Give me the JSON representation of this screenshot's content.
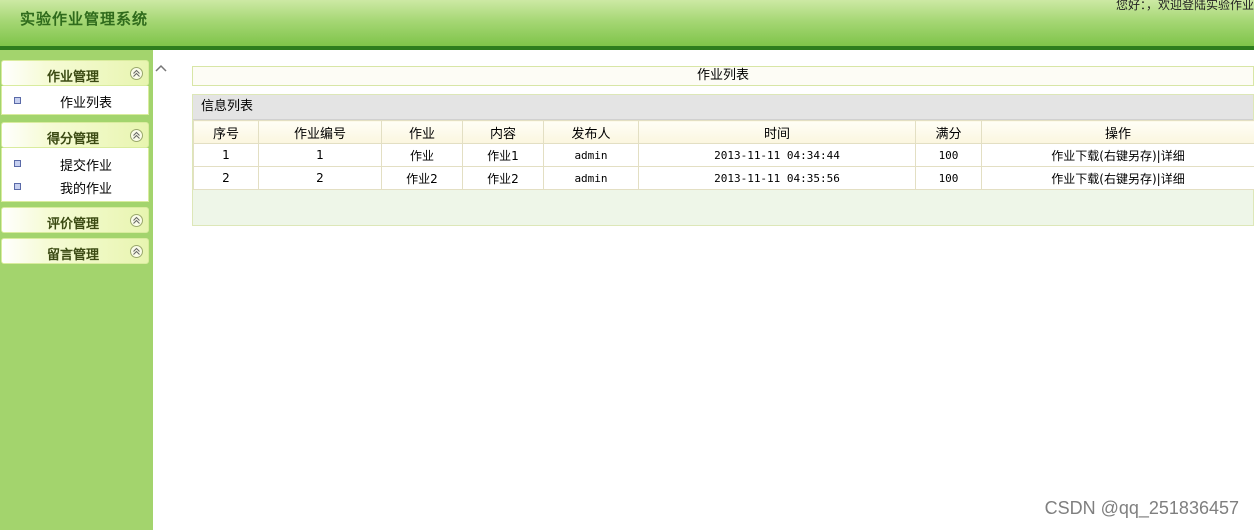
{
  "header": {
    "app_title": "实验作业管理系统",
    "welcome_text": "您好：，欢迎登陆实验作业"
  },
  "sidebar": {
    "groups": [
      {
        "title": "作业管理",
        "items": [
          "作业列表"
        ]
      },
      {
        "title": "得分管理",
        "items": [
          "提交作业",
          "我的作业"
        ]
      },
      {
        "title": "评价管理",
        "items": []
      },
      {
        "title": "留言管理",
        "items": []
      }
    ]
  },
  "main": {
    "title": "作业列表",
    "panel_title": "信息列表",
    "columns": [
      "序号",
      "作业编号",
      "作业",
      "内容",
      "发布人",
      "时间",
      "满分",
      "操作"
    ],
    "rows": [
      [
        "1",
        "1",
        "作业",
        "作业1",
        "admin",
        "2013-11-11 04:34:44",
        "100",
        "作业下载(右键另存)|详细"
      ],
      [
        "2",
        "2",
        "作业2",
        "作业2",
        "admin",
        "2013-11-11 04:35:56",
        "100",
        "作业下载(右键另存)|详细"
      ]
    ]
  },
  "watermark": "CSDN @qq_251836457",
  "icons": {
    "collapse": "chevron-up-icon",
    "group_toggle": "double-chevron-up-icon",
    "menu_bullet": "square-bullet-icon"
  },
  "colors": {
    "header_green": "#7fc44a",
    "sidebar_green": "#a3d46d",
    "header_border": "#2e7d1e"
  }
}
